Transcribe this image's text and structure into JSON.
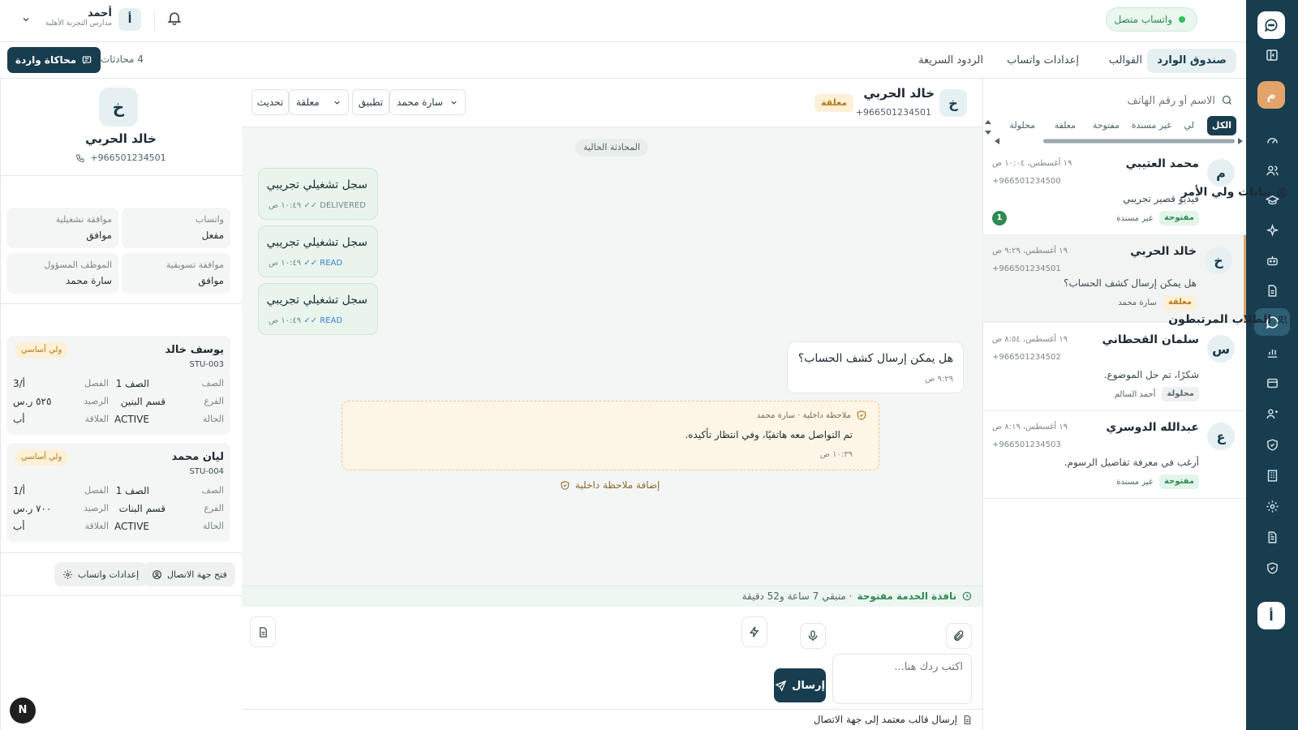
{
  "user": {
    "name": "أحمد",
    "org": "مدارس التجربة الأهلية",
    "initial": "أ"
  },
  "whatsapp_status": "واتساب متصل",
  "tabs": [
    "صندوق الوارد",
    "القوالب",
    "إعدادات واتساب",
    "الردود السريعة"
  ],
  "conversations_count": "4 محادثات",
  "simulate_button": "محاكاة واردة",
  "rail": {
    "profile_initial": "م",
    "bottom_initial": "أ"
  },
  "inbox": {
    "search_placeholder": "الاسم أو رقم الهاتف",
    "filters": [
      "الكل",
      "لي",
      "غير مسندة",
      "مفتوحة",
      "معلقة",
      "محلولة"
    ],
    "items": [
      {
        "initial": "م",
        "name": "محمد العتيبي",
        "time": "١٩ أغسطس، ١٠:٠٤ ص",
        "phone": "+966501234500",
        "preview": "فيديو قصير تجريبي",
        "status": "مفتوحة",
        "assignee": "غير مسندة",
        "unread": "1"
      },
      {
        "initial": "خ",
        "name": "خالد الحربي",
        "time": "١٩ أغسطس، ٩:٢٩ ص",
        "phone": "+966501234501",
        "preview": "هل يمكن إرسال كشف الحساب؟",
        "status": "معلقة",
        "assignee": "سارة محمد"
      },
      {
        "initial": "س",
        "name": "سلمان القحطاني",
        "time": "١٩ أغسطس، ٨:٥٤ ص",
        "phone": "+966501234502",
        "preview": "شكرًا، تم حل الموضوع.",
        "status": "محلولة",
        "assignee": "أحمد السالم"
      },
      {
        "initial": "ع",
        "name": "عبدالله الدوسري",
        "time": "١٩ أغسطس، ٨:١٩ ص",
        "phone": "+966501234503",
        "preview": "أرغب في معرفة تفاصيل الرسوم.",
        "status": "مفتوحة",
        "assignee": "غير مسندة"
      }
    ]
  },
  "chat": {
    "initial": "خ",
    "name": "خالد الحربي",
    "phone": "+966501234501",
    "status": "معلقة",
    "assignee_select": "سارة محمد",
    "apply": "تطبيق",
    "status_select": "معلقة",
    "refresh": "تحديث",
    "current_label": "المحادثة الحالية",
    "outgoing": [
      {
        "text": "سجل تشغيلي تجريبي",
        "time": "١٠:٤٩ ص",
        "state": "DELIVERED"
      },
      {
        "text": "سجل تشغيلي تجريبي",
        "time": "١٠:٤٩ ص",
        "state": "READ"
      },
      {
        "text": "سجل تشغيلي تجريبي",
        "time": "١٠:٤٩ ص",
        "state": "READ"
      }
    ],
    "incoming": {
      "text": "هل يمكن إرسال كشف الحساب؟",
      "time": "٩:٢٩ ص"
    },
    "note": {
      "header": "ملاحظة داخلية · سارة محمد",
      "text": "تم التواصل معه هاتفيًا، وفي انتظار تأكيده.",
      "time": "١٠:٣٩ ص"
    },
    "add_note": "إضافة ملاحظة داخلية",
    "service_window_label": "نافذة الخدمة مفتوحة",
    "service_window_remaining": "· متبقي 7 ساعة و52 دقيقة",
    "reply_placeholder": "اكتب ردك هنا...",
    "send": "إرسال",
    "send_template": "إرسال قالب معتمد إلى جهة الاتصال"
  },
  "contact": {
    "initial": "خ",
    "name": "خالد الحربي",
    "phone": "+966501234501",
    "guardian_title": "بيانات ولي الأمر",
    "fields": [
      {
        "label": "واتساب",
        "value": "مفعل"
      },
      {
        "label": "موافقة تشغيلية",
        "value": "موافق"
      },
      {
        "label": "موافقة تسويقية",
        "value": "موافق"
      },
      {
        "label": "الموظف المسؤول",
        "value": "سارة محمد"
      }
    ],
    "students_title": "الطلاب المرتبطون",
    "students": [
      {
        "name": "يوسف خالد",
        "code": "STU-003",
        "badge": "ولي أساسي",
        "rows": [
          {
            "l1": "الصف",
            "v1": "الصف 1",
            "l2": "الفصل",
            "v2": "أ/3"
          },
          {
            "l1": "الفرع",
            "v1": "قسم البنين",
            "l2": "الرصيد",
            "v2": "٥٢٥ ر.س"
          },
          {
            "l1": "الحالة",
            "v1": "ACTIVE",
            "l2": "العلاقة",
            "v2": "أب"
          }
        ]
      },
      {
        "name": "ليان محمد",
        "code": "STU-004",
        "badge": "ولي أساسي",
        "rows": [
          {
            "l1": "الصف",
            "v1": "الصف 1",
            "l2": "الفصل",
            "v2": "أ/1"
          },
          {
            "l1": "الفرع",
            "v1": "قسم البنات",
            "l2": "الرصيد",
            "v2": "٧٠٠ ر.س"
          },
          {
            "l1": "الحالة",
            "v1": "ACTIVE",
            "l2": "العلاقة",
            "v2": "أب"
          }
        ]
      }
    ],
    "open_contact": "فتح جهة الاتصال",
    "wa_settings": "إعدادات واتساب"
  },
  "corner_badge": "N",
  "colors": {
    "primary": "#183d4f",
    "accent": "#e4a36a",
    "open": "#2e8a52",
    "pending": "#b47a1a"
  }
}
